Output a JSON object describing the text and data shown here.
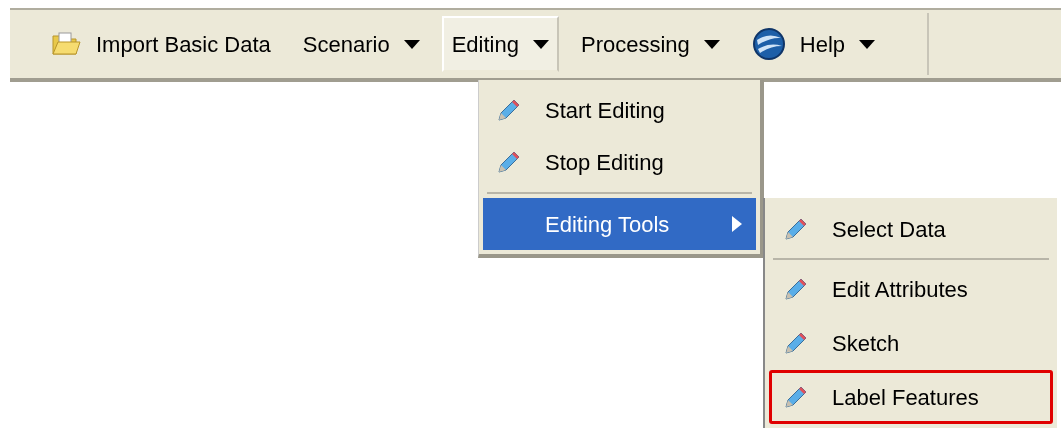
{
  "toolbar": {
    "items": [
      {
        "kind": "action",
        "label": "Import Basic Data",
        "open": false
      },
      {
        "kind": "dropdown",
        "label": "Scenario",
        "open": false
      },
      {
        "kind": "dropdown",
        "label": "Editing",
        "open": true
      },
      {
        "kind": "dropdown",
        "label": "Processing",
        "open": false
      },
      {
        "kind": "dropdown",
        "label": "Help",
        "open": false
      }
    ]
  },
  "menu": {
    "items": [
      {
        "kind": "item",
        "label": "Start Editing",
        "selected": false
      },
      {
        "kind": "item",
        "label": "Stop Editing",
        "selected": false
      },
      {
        "kind": "separator"
      },
      {
        "kind": "submenu",
        "label": "Editing Tools",
        "selected": true
      }
    ]
  },
  "submenu": {
    "items": [
      {
        "kind": "item",
        "label": "Select Data",
        "outlined": false
      },
      {
        "kind": "separator"
      },
      {
        "kind": "item",
        "label": "Edit Attributes",
        "outlined": false
      },
      {
        "kind": "item",
        "label": "Sketch",
        "outlined": false
      },
      {
        "kind": "item",
        "label": "Label Features",
        "outlined": true
      }
    ]
  }
}
